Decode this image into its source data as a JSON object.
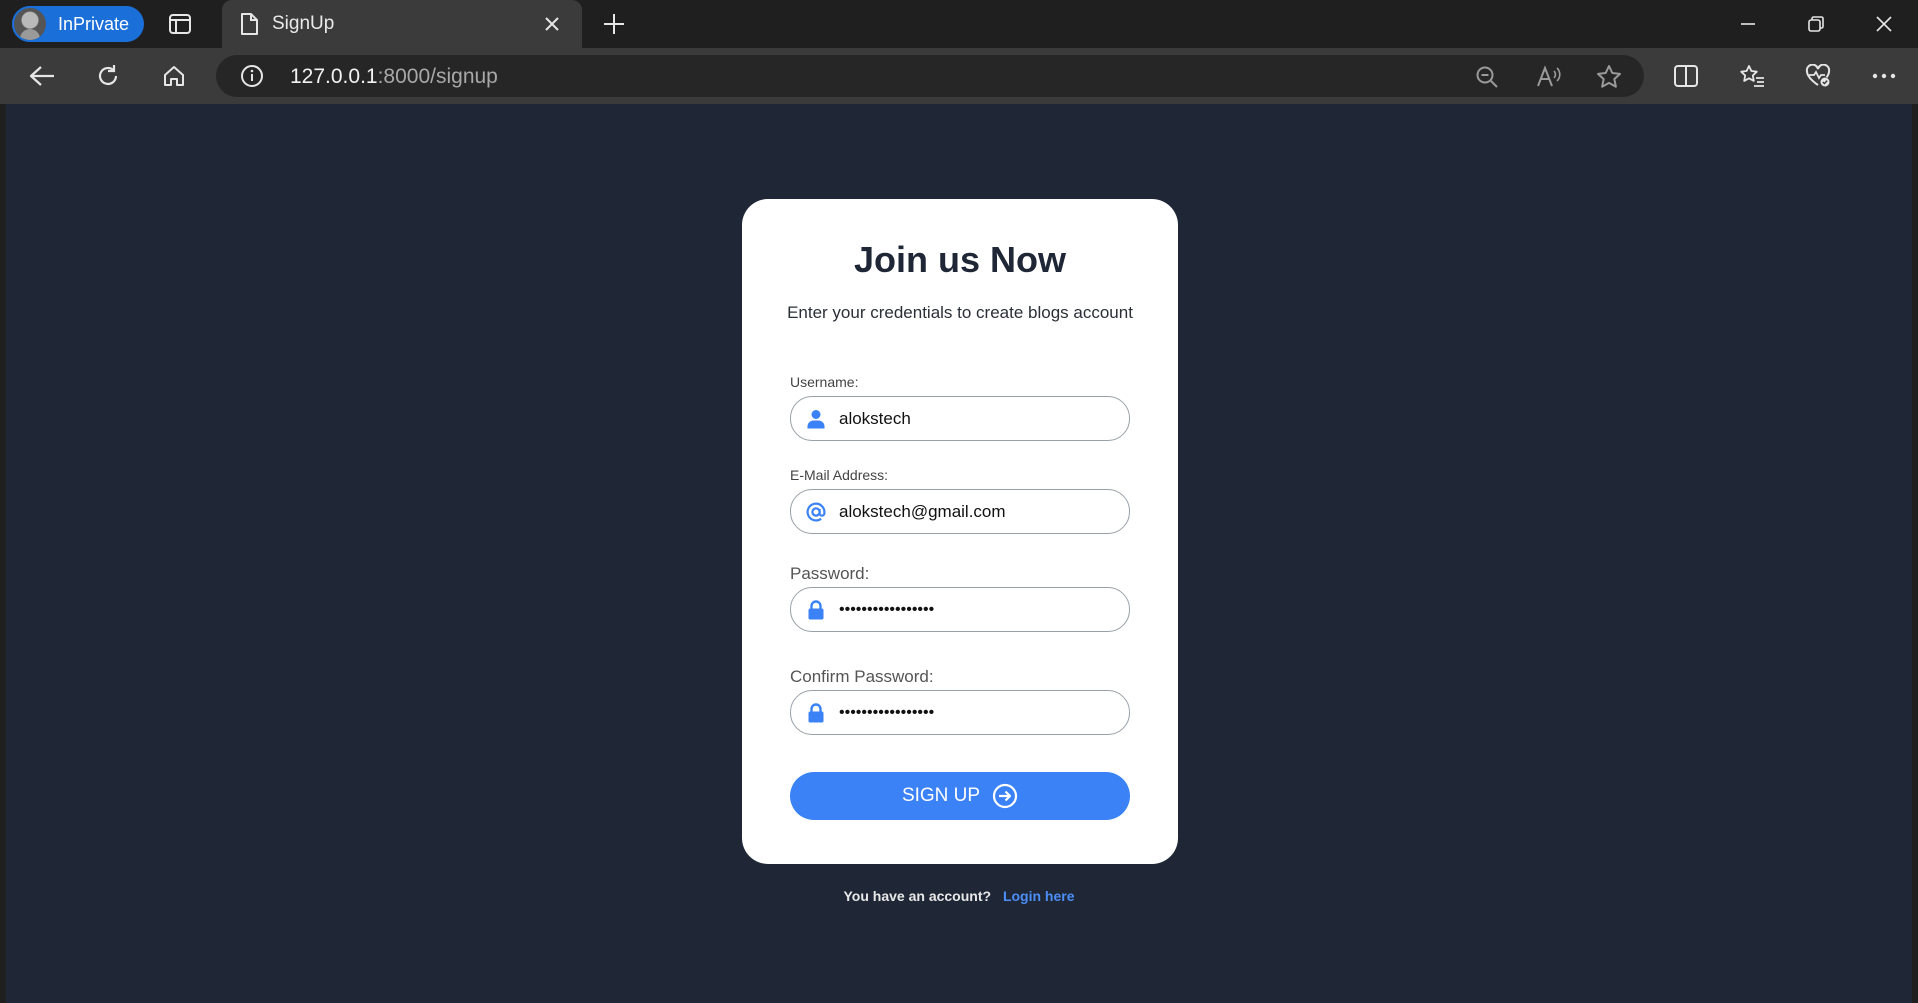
{
  "browser": {
    "profile_label": "InPrivate",
    "tab_title": "SignUp",
    "url_host": "127.0.0.1",
    "url_rest": ":8000/signup"
  },
  "icons": {
    "accent": "#3b82f6",
    "page_bg": "#1f2737"
  },
  "signup": {
    "title": "Join us Now",
    "subtitle": "Enter your credentials to create blogs account",
    "username_label": "Username:",
    "username_value": "alokstech",
    "email_label": "E-Mail Address:",
    "email_value": "alokstech@gmail.com",
    "password_label": "Password:",
    "password_value": "•••••••••••••••••",
    "confirm_label": "Confirm Password:",
    "confirm_value": "•••••••••••••••••",
    "submit_label": "SIGN UP"
  },
  "footer": {
    "prompt": "You have an account?",
    "login_link": "Login here"
  }
}
